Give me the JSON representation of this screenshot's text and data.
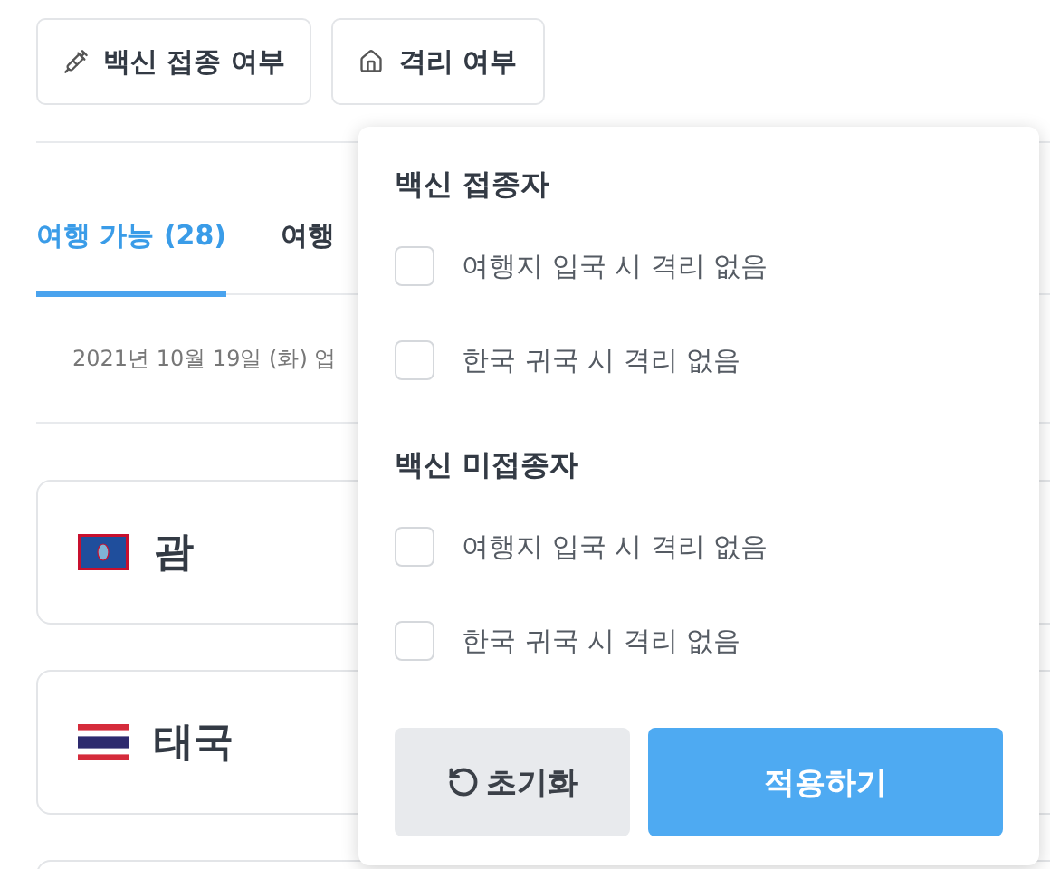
{
  "filter_buttons": [
    {
      "kind": "vaccine",
      "label": "백신 접종 여부"
    },
    {
      "kind": "quarantine",
      "label": "격리 여부"
    }
  ],
  "tabs": [
    {
      "label": "여행 가능 (28)",
      "selected": true
    },
    {
      "label": "여행",
      "selected": false
    }
  ],
  "update_note": "2021년 10월 19일 (화) 업",
  "countries": [
    {
      "kind": "guam",
      "name": "괌"
    },
    {
      "kind": "thailand",
      "name": "태국"
    },
    {
      "kind": "blank"
    }
  ],
  "popup": {
    "groups": [
      {
        "title": "백신 접종자",
        "options": [
          {
            "label": "여행지 입국 시 격리 없음",
            "checked": false
          },
          {
            "label": "한국 귀국 시 격리 없음",
            "checked": false
          }
        ]
      },
      {
        "title": "백신 미접종자",
        "options": [
          {
            "label": "여행지 입국 시 격리 없음",
            "checked": false
          },
          {
            "label": "한국 귀국 시 격리 없음",
            "checked": false
          }
        ]
      }
    ],
    "reset_button": "초기화",
    "apply_button": "적용하기"
  }
}
